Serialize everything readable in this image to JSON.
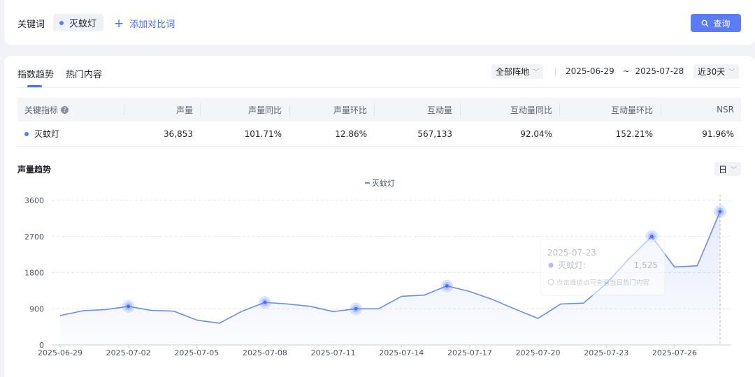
{
  "keywords": {
    "label": "关键词",
    "chip": "灭蚊灯",
    "add_compare": "添加对比词",
    "query_button": "查询",
    "accent_color": "#5b7cf2"
  },
  "tabs": [
    {
      "label": "指数趋势",
      "active": true
    },
    {
      "label": "热门内容",
      "active": false
    }
  ],
  "filters": {
    "position": "全部阵地",
    "date_start": "2025-06-29",
    "date_sep": "~",
    "date_end": "2025-07-28",
    "range": "近30天"
  },
  "table": {
    "headers": [
      "关键指标",
      "声量",
      "声量同比",
      "声量环比",
      "互动量",
      "互动量同比",
      "互动量环比",
      "NSR"
    ],
    "rows": [
      {
        "name": "灭蚊灯",
        "values": [
          "36,853",
          "101.71%",
          "12.86%",
          "567,133",
          "92.04%",
          "152.21%",
          "91.96%"
        ]
      }
    ]
  },
  "section": {
    "title": "声量趋势",
    "granularity": "日"
  },
  "chart_data": {
    "type": "line",
    "series": [
      {
        "name": "灭蚊灯",
        "color": "#6b8cf5",
        "x": [
          "2025-06-29",
          "2025-06-30",
          "2025-07-01",
          "2025-07-02",
          "2025-07-03",
          "2025-07-04",
          "2025-07-05",
          "2025-07-06",
          "2025-07-07",
          "2025-07-08",
          "2025-07-09",
          "2025-07-10",
          "2025-07-11",
          "2025-07-12",
          "2025-07-13",
          "2025-07-14",
          "2025-07-15",
          "2025-07-16",
          "2025-07-17",
          "2025-07-18",
          "2025-07-19",
          "2025-07-20",
          "2025-07-21",
          "2025-07-22",
          "2025-07-23",
          "2025-07-24",
          "2025-07-25",
          "2025-07-26",
          "2025-07-27",
          "2025-07-28"
        ],
        "values": [
          730,
          850,
          880,
          960,
          860,
          840,
          620,
          540,
          840,
          1060,
          1020,
          960,
          830,
          900,
          900,
          1210,
          1240,
          1470,
          1330,
          1130,
          890,
          660,
          1020,
          1040,
          1525,
          2150,
          2700,
          1940,
          1970,
          3320
        ],
        "highlight_points": [
          "2025-07-02",
          "2025-07-08",
          "2025-07-12",
          "2025-07-16",
          "2025-07-25",
          "2025-07-28"
        ]
      }
    ],
    "x_tick_labels": [
      "2025-06-29",
      "2025-07-02",
      "2025-07-05",
      "2025-07-08",
      "2025-07-11",
      "2025-07-14",
      "2025-07-17",
      "2025-07-20",
      "2025-07-23",
      "2025-07-26"
    ],
    "y_ticks": [
      0,
      900,
      1800,
      2700,
      3600
    ],
    "ylim": [
      0,
      3600
    ],
    "grid": true,
    "legend": "top-center",
    "tooltip": {
      "date": "2025-07-23",
      "series": "灭蚊灯:",
      "value": "1,525",
      "hint": "点击峰值点可查看当日热门内容"
    }
  }
}
